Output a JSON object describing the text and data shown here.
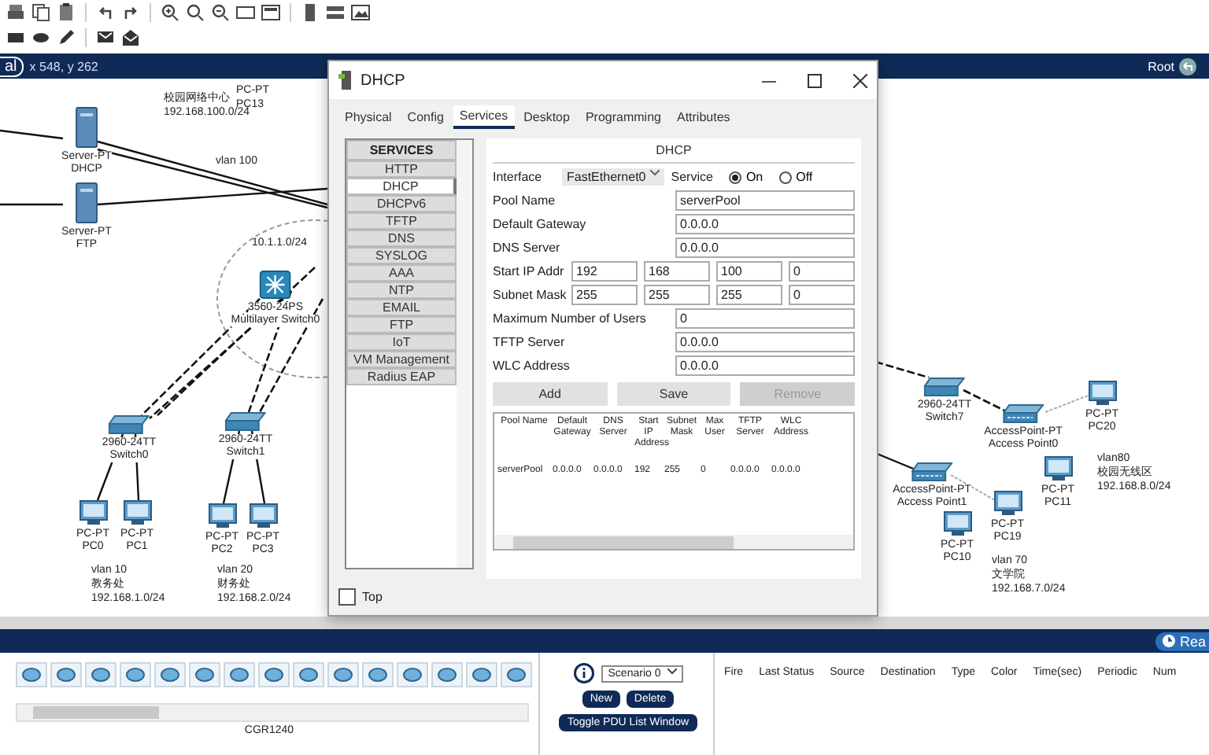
{
  "workspace": {
    "mode_tab": "al",
    "coordinates": "x 548, y 262",
    "root_label": "Root"
  },
  "canvas": {
    "nodes": [
      {
        "kind": "server",
        "model": "Server-PT",
        "name": "DHCP"
      },
      {
        "kind": "server",
        "model": "Server-PT",
        "name": "FTP"
      },
      {
        "kind": "multilayer",
        "model": "3560-24PS",
        "name": "Multilayer Switch0"
      },
      {
        "kind": "switch",
        "model": "2960-24TT",
        "name": "Switch0"
      },
      {
        "kind": "switch",
        "model": "2960-24TT",
        "name": "Switch1"
      },
      {
        "kind": "pc",
        "model": "PC-PT",
        "name": "PC0"
      },
      {
        "kind": "pc",
        "model": "PC-PT",
        "name": "PC1"
      },
      {
        "kind": "pc",
        "model": "PC-PT",
        "name": "PC2"
      },
      {
        "kind": "pc",
        "model": "PC-PT",
        "name": "PC3"
      },
      {
        "kind": "switch",
        "model": "2960-24TT",
        "name": "Switch7"
      },
      {
        "kind": "ap",
        "model": "AccessPoint-PT",
        "name": "Access Point0"
      },
      {
        "kind": "pc",
        "model": "PC-PT",
        "name": "PC20"
      },
      {
        "kind": "ap",
        "model": "AccessPoint-PT",
        "name": "Access Point1"
      },
      {
        "kind": "pc",
        "model": "PC-PT",
        "name": "PC11"
      },
      {
        "kind": "pc",
        "model": "PC-PT",
        "name": "PC19"
      },
      {
        "kind": "pc",
        "model": "PC-PT",
        "name": "PC10"
      }
    ],
    "notes": [
      {
        "lines": [
          "PC-PT",
          "PC13"
        ]
      },
      {
        "lines": [
          "校园网络中心",
          "192.168.100.0/24"
        ]
      },
      {
        "lines": [
          "vlan 100"
        ]
      },
      {
        "lines": [
          "10.1.1.0/24"
        ]
      },
      {
        "lines": [
          "vlan 10",
          "教务处",
          "192.168.1.0/24"
        ]
      },
      {
        "lines": [
          "vlan 20",
          "财务处",
          "192.168.2.0/24"
        ]
      },
      {
        "lines": [
          "vlan 70",
          "文学院",
          "192.168.7.0/24"
        ]
      },
      {
        "lines": [
          "vlan80",
          "校园无线区",
          "192.168.8.0/24"
        ]
      }
    ]
  },
  "dialog": {
    "title": "DHCP",
    "tabs": [
      {
        "label": "Physical",
        "selected": false
      },
      {
        "label": "Config",
        "selected": false
      },
      {
        "label": "Services",
        "selected": true
      },
      {
        "label": "Desktop",
        "selected": false
      },
      {
        "label": "Programming",
        "selected": false
      },
      {
        "label": "Attributes",
        "selected": false
      }
    ],
    "services_heading": "SERVICES",
    "services": [
      {
        "label": "HTTP",
        "selected": false
      },
      {
        "label": "DHCP",
        "selected": true
      },
      {
        "label": "DHCPv6",
        "selected": false
      },
      {
        "label": "TFTP",
        "selected": false
      },
      {
        "label": "DNS",
        "selected": false
      },
      {
        "label": "SYSLOG",
        "selected": false
      },
      {
        "label": "AAA",
        "selected": false
      },
      {
        "label": "NTP",
        "selected": false
      },
      {
        "label": "EMAIL",
        "selected": false
      },
      {
        "label": "FTP",
        "selected": false
      },
      {
        "label": "IoT",
        "selected": false
      },
      {
        "label": "VM Management",
        "selected": false
      },
      {
        "label": "Radius EAP",
        "selected": false
      }
    ],
    "panel_title": "DHCP",
    "interface_label": "Interface",
    "interface_value": "FastEthernet0",
    "service_label": "Service",
    "service_options": [
      {
        "label": "On",
        "selected": true
      },
      {
        "label": "Off",
        "selected": false
      }
    ],
    "fields": [
      {
        "kind": "single",
        "label": "Pool Name",
        "value": "serverPool"
      },
      {
        "kind": "single",
        "label": "Default Gateway",
        "value": "0.0.0.0"
      },
      {
        "kind": "single",
        "label": "DNS Server",
        "value": "0.0.0.0"
      },
      {
        "kind": "octets",
        "label": "Start IP Addr",
        "values": [
          "192",
          "168",
          "100",
          "0"
        ]
      },
      {
        "kind": "octets",
        "label": "Subnet Mask",
        "values": [
          "255",
          "255",
          "255",
          "0"
        ]
      },
      {
        "kind": "single",
        "label": "Maximum Number of Users",
        "value": "0"
      },
      {
        "kind": "single",
        "label": "TFTP Server",
        "value": "0.0.0.0"
      },
      {
        "kind": "single",
        "label": "WLC Address",
        "value": "0.0.0.0"
      }
    ],
    "buttons": [
      {
        "label": "Add",
        "disabled": false
      },
      {
        "label": "Save",
        "disabled": false
      },
      {
        "label": "Remove",
        "disabled": true
      }
    ],
    "table": {
      "columns": [
        "Pool Name",
        "Default Gateway",
        "DNS Server",
        "Start IP Address",
        "Subnet Mask",
        "Max User",
        "TFTP Server",
        "WLC Address"
      ],
      "rows": [
        [
          "serverPool",
          "0.0.0.0",
          "0.0.0.0",
          "192",
          "255",
          "0",
          "0.0.0.0",
          "0.0.0.0"
        ]
      ]
    },
    "top_checkbox": {
      "label": "Top",
      "checked": false
    }
  },
  "realtime_label": "Rea",
  "device_tray": {
    "selected_device": "CGR1240"
  },
  "scenario": {
    "value": "Scenario 0",
    "buttons": [
      "New",
      "Delete"
    ],
    "toggle_button": "Toggle PDU List Window",
    "columns": [
      "Fire",
      "Last Status",
      "Source",
      "Destination",
      "Type",
      "Color",
      "Time(sec)",
      "Periodic",
      "Num"
    ]
  }
}
